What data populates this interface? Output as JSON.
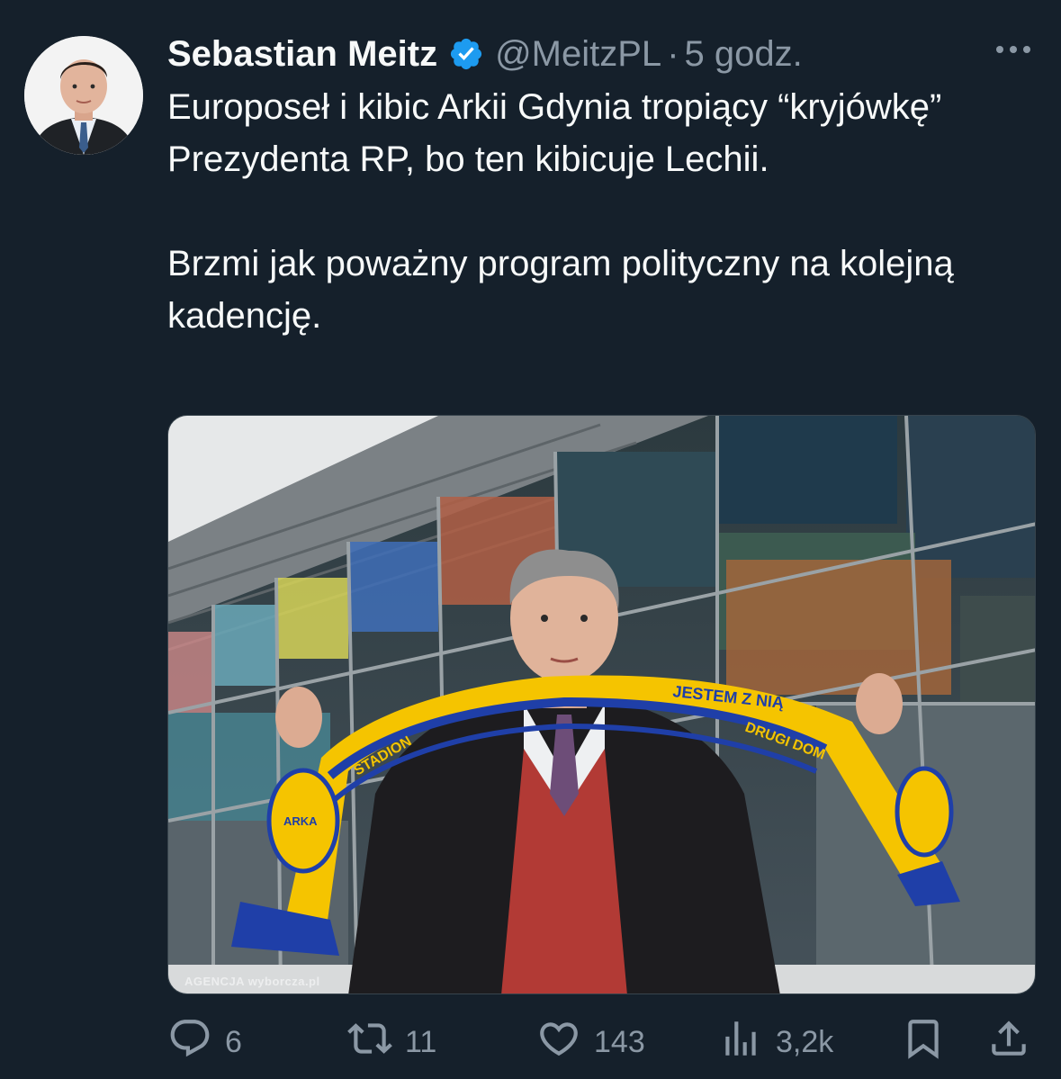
{
  "author": {
    "name": "Sebastian Meitz",
    "handle": "@MeitzPL",
    "separator": "·",
    "time": "5 godz.",
    "verified": true
  },
  "tweet": {
    "paragraph1": "Europoseł i kibic Arkii Gdynia tropiący “kryjówkę” Prezydenta RP, bo ten kibicuje Lechii.",
    "paragraph2": "Brzmi jak poważny program polityczny na kolejną kadencję."
  },
  "media": {
    "watermark": "AGENCJA wyborcza.pl",
    "scarf_text_top": "JESTEM Z NIĄ",
    "scarf_text_left": "STADION",
    "scarf_text_right": "DRUGI DOM",
    "badge_text": "ARKA"
  },
  "actions": {
    "replies": "6",
    "reposts": "11",
    "likes": "143",
    "views": "3,2k"
  },
  "colors": {
    "background": "#15202b",
    "text": "#f7f9f9",
    "secondary": "#8b98a5",
    "verified": "#1d9bf0",
    "scarf_yellow": "#f5c400",
    "scarf_blue": "#1f3fa8"
  },
  "icons": [
    "verified-badge-icon",
    "more-icon",
    "reply-icon",
    "repost-icon",
    "like-icon",
    "views-icon",
    "bookmark-icon",
    "share-icon"
  ]
}
